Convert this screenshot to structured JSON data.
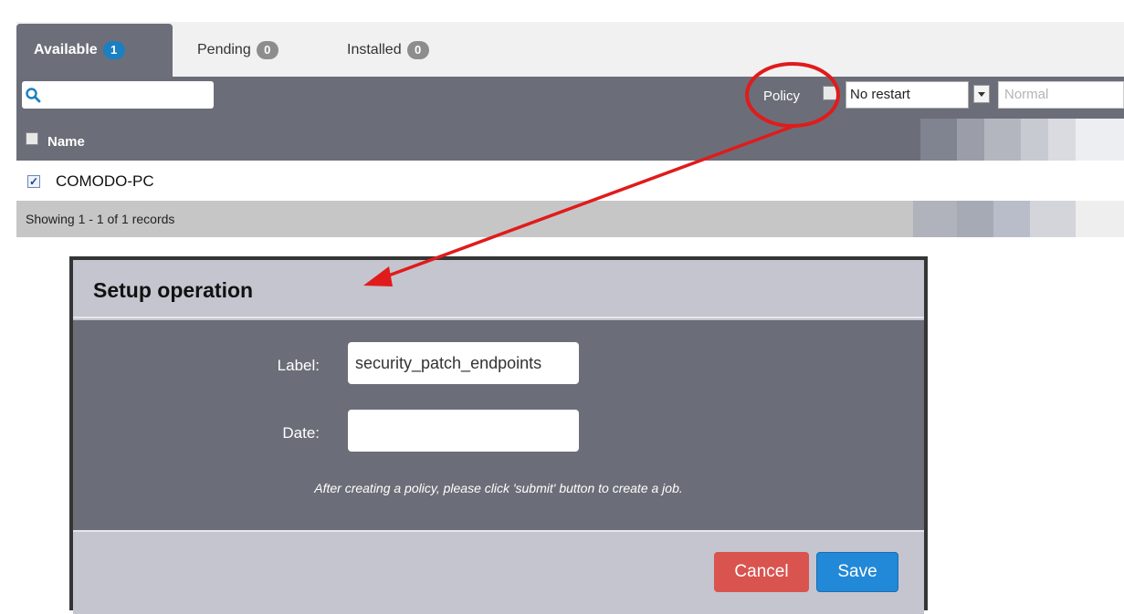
{
  "tabs": [
    {
      "label": "Available",
      "count": "1"
    },
    {
      "label": "Pending",
      "count": "0"
    },
    {
      "label": "Installed",
      "count": "0"
    }
  ],
  "toolbar": {
    "search_placeholder": "",
    "policy_label": "Policy",
    "restart_value": "No restart",
    "priority_value": "Normal"
  },
  "table": {
    "column_name": "Name",
    "rows": [
      {
        "name": "COMODO-PC",
        "checked": true
      }
    ],
    "footer": "Showing 1 - 1 of 1 records"
  },
  "dialog": {
    "title": "Setup operation",
    "label_field": {
      "label": "Label:",
      "value": "security_patch_endpoints"
    },
    "date_field": {
      "label": "Date:",
      "value": ""
    },
    "note": "After creating a policy, please click 'submit' button to create a job.",
    "cancel": "Cancel",
    "save": "Save"
  },
  "colors": {
    "header_grey": "#6b6e78",
    "badge_blue": "#1c7fc1",
    "cancel_red": "#d9534f",
    "save_blue": "#2288d8",
    "annotation_red": "#e01b1b"
  }
}
